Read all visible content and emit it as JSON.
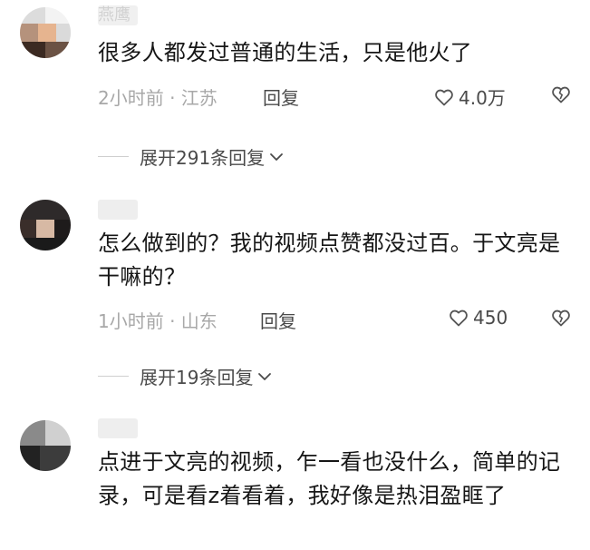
{
  "comments": [
    {
      "username": "燕鹰",
      "text": "很多人都发过普通的生活，只是他火了",
      "time_location": "2小时前 · 江苏",
      "reply_label": "回复",
      "likes": "4.0万",
      "expand_label": "展开291条回复"
    },
    {
      "username": "",
      "text": "怎么做到的？我的视频点赞都没过百。于文亮是干嘛的？",
      "time_location": "1小时前 · 山东",
      "reply_label": "回复",
      "likes": "450",
      "expand_label": "展开19条回复"
    },
    {
      "username": "",
      "text": "点进于文亮的视频，乍一看也没什么，简单的记录，可是看z着看着，我好像是热泪盈眶了"
    }
  ],
  "icons": {
    "like": "heart-outline-icon",
    "dislike": "broken-heart-icon",
    "expand": "chevron-down-icon"
  },
  "colors": {
    "text": "#161616",
    "meta": "#a8a8a8",
    "secondary": "#4a4a4a"
  }
}
